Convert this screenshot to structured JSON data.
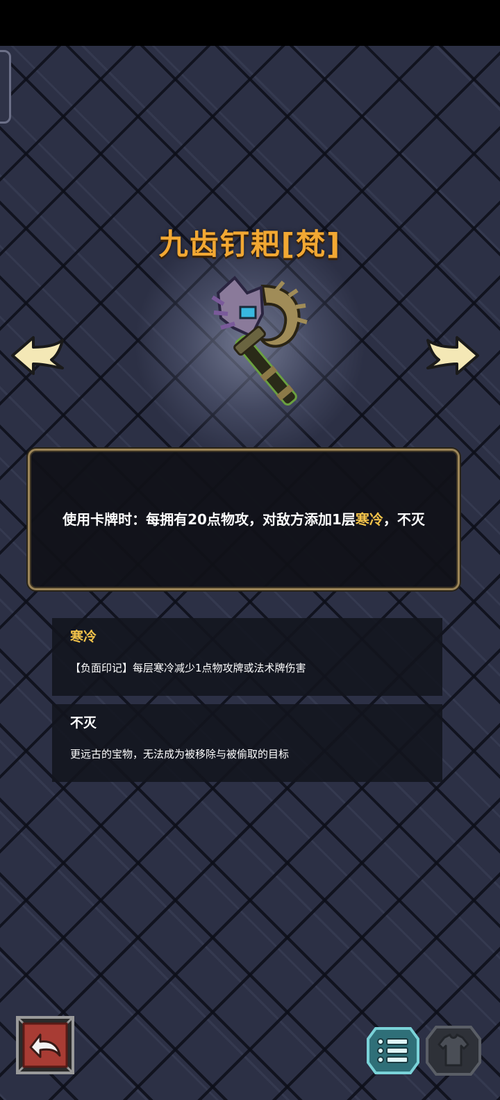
{
  "item": {
    "title": "九齿钉耙[梵]",
    "description_prefix": "使用卡牌时：每拥有20点物攻，对敌方添加1层",
    "description_keyword1": "寒冷",
    "description_sep": "，",
    "description_keyword2": "不灭"
  },
  "keywords": [
    {
      "title": "寒冷",
      "desc": "【负面印记】每层寒冷减少1点物攻牌或法术牌伤害"
    },
    {
      "title": "不灭",
      "desc": "更远古的宝物，无法成为被移除与被偷取的目标"
    }
  ],
  "icons": {
    "weapon": "rake-weapon-icon",
    "prev": "left-arrow-icon",
    "next": "right-arrow-icon",
    "back": "back-arrow-icon",
    "list": "list-icon",
    "equipment": "shirt-icon"
  },
  "colors": {
    "title": "#f2a833",
    "keyword": "#f2c24a",
    "panel_border": "#9c8558",
    "list_button": "#62c2c8"
  }
}
